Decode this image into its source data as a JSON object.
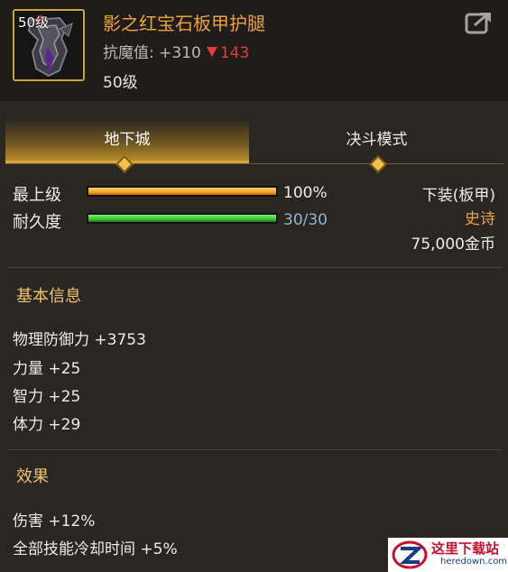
{
  "item": {
    "level_badge": "50级",
    "name": "影之红宝石板甲护腿",
    "anti_magic_label": "抗魔值: +310",
    "anti_magic_down": "143",
    "level_text": "50级"
  },
  "tabs": [
    {
      "label": "地下城",
      "active": true
    },
    {
      "label": "决斗模式",
      "active": false
    }
  ],
  "stats": {
    "max_level_label": "最上级",
    "max_level_value": "100%",
    "max_level_fraction": 1.0,
    "durability_label": "耐久度",
    "durability_value": "30/30",
    "durability_fraction": 1.0
  },
  "info": {
    "slot": "下装(板甲)",
    "rarity": "史诗",
    "price": "75,000金币"
  },
  "basic": {
    "title": "基本信息",
    "attrs": [
      "物理防御力 +3753",
      "力量 +25",
      "智力 +25",
      "体力 +29"
    ]
  },
  "effects": {
    "title": "效果",
    "items": [
      "伤害 +12%",
      "全部技能冷却时间 +5%"
    ]
  },
  "colors": {
    "rarity": "#f0a23a",
    "max_bar": "#f5a623",
    "durability_bar": "#3ec43a",
    "durability_text": "#8fb4d8"
  },
  "icons": {
    "share": "share-icon",
    "item": "leg-armor-icon"
  },
  "watermark": {
    "cn": "这里下载站",
    "en": "heredown.com"
  }
}
